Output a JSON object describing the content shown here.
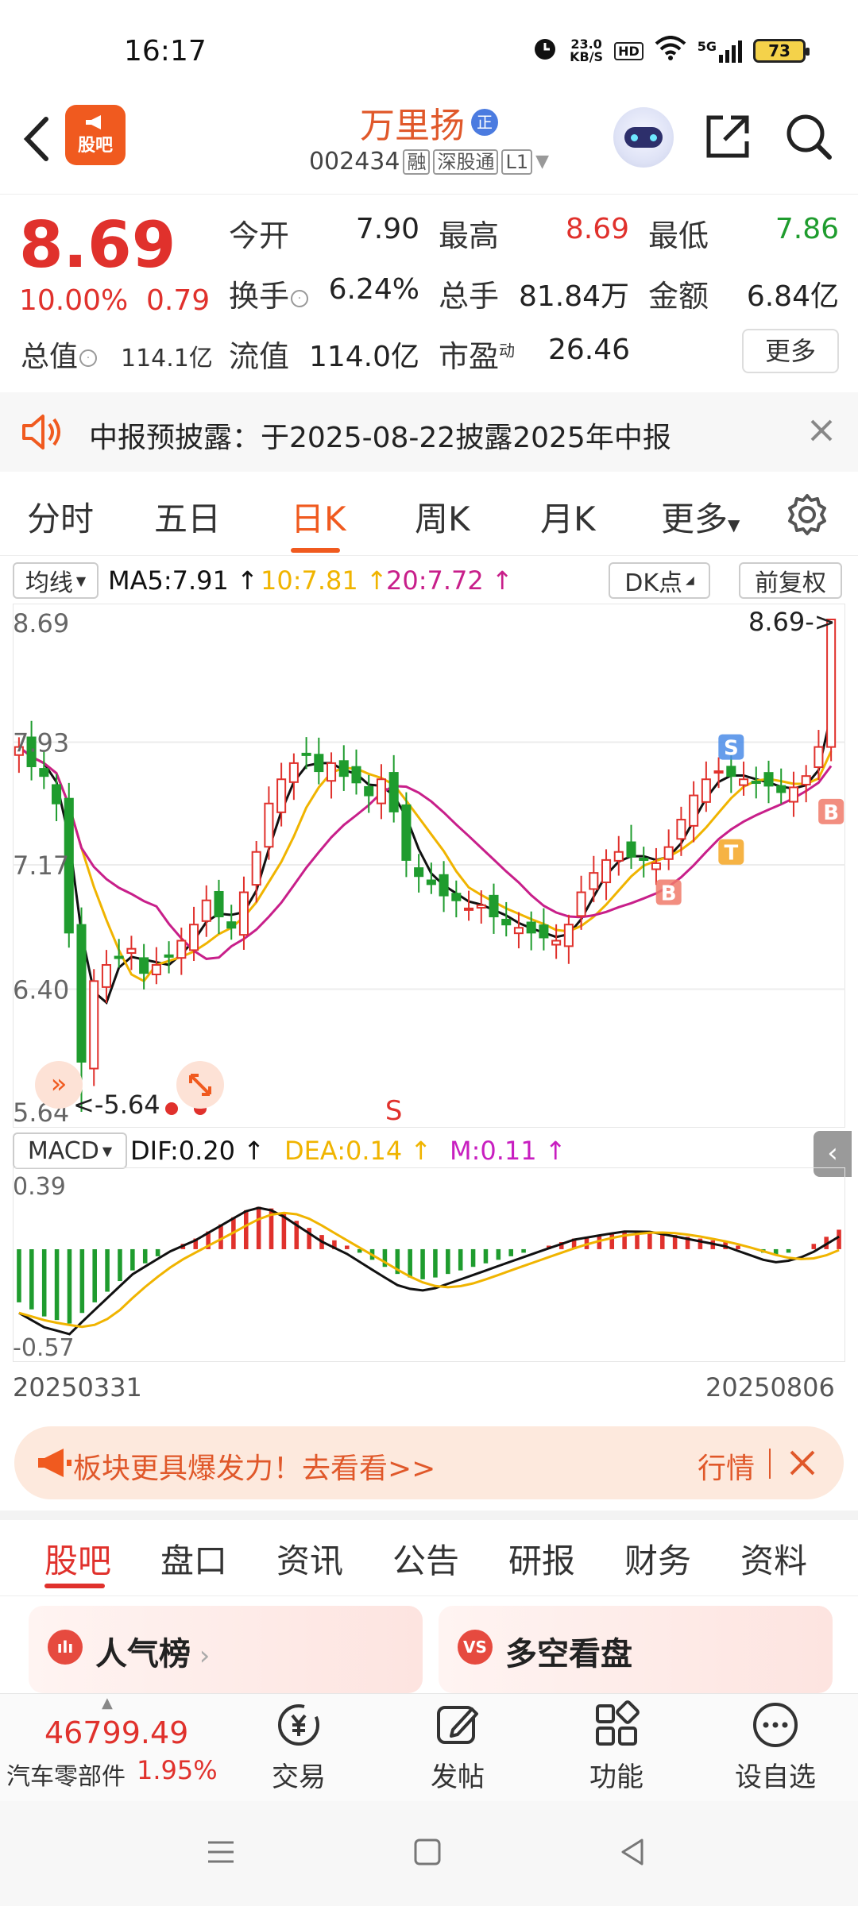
{
  "status_bar": {
    "time": "16:17",
    "net_speed_value": "23.0",
    "net_speed_unit": "KB/S",
    "hd": "HD",
    "network": "5G",
    "battery": "73"
  },
  "header": {
    "back_glyph": "‹",
    "logo_text": "股吧",
    "stock_name": "万里扬",
    "name_badge": "正",
    "stock_code": "002434",
    "tag_margin": "融",
    "tag_connect": "深股通",
    "tag_level": "L1"
  },
  "quote": {
    "price": "8.69",
    "change_pct": "10.00%",
    "change_amt": "0.79",
    "total_mv_label": "总值",
    "total_mv_value": "114.1亿",
    "open_label": "今开",
    "open_value": "7.90",
    "high_label": "最高",
    "high_value": "8.69",
    "low_label": "最低",
    "low_value": "7.86",
    "turnover_label": "换手",
    "turnover_value": "6.24%",
    "volume_label": "总手",
    "volume_value": "81.84万",
    "amount_label": "金额",
    "amount_value": "6.84亿",
    "float_mv_label": "流值",
    "float_mv_value": "114.0亿",
    "pe_label": "市盈",
    "pe_sup": "动",
    "pe_value": "26.46",
    "more_label": "更多"
  },
  "announcement": {
    "text": "中报预披露：于2025-08-22披露2025年中报"
  },
  "period_tabs": {
    "items": [
      "分时",
      "五日",
      "日K",
      "周K",
      "月K",
      "更多"
    ],
    "active": "日K"
  },
  "ma_legend": {
    "selector": "均线",
    "ma5": "MA5:7.91",
    "ma10": "10:7.81",
    "ma20": "20:7.72",
    "dk_label": "DK点",
    "adjust_label": "前复权"
  },
  "macd_legend": {
    "selector": "MACD",
    "dif": "DIF:0.20",
    "dea": "DEA:0.14",
    "m": "M:0.11"
  },
  "colors": {
    "up": "#e0312c",
    "down": "#1f9c2e",
    "ma5": "#111111",
    "ma10": "#f0b400",
    "ma20": "#c81f8a",
    "accent": "#f05a1f"
  },
  "chart_data": [
    {
      "type": "candlestick",
      "y_ticks": [
        "8.69",
        "7.93",
        "7.17",
        "6.40",
        "5.64"
      ],
      "ylim": [
        5.64,
        8.69
      ],
      "x_start_label": "20250331",
      "x_end_label": "20250806",
      "last_price_label": "8.69->",
      "low_label": "<-5.64",
      "markers": [
        "S",
        "B",
        "T",
        "B",
        "S"
      ],
      "closes": [
        7.9,
        7.78,
        7.72,
        7.55,
        6.75,
        5.95,
        6.45,
        6.55,
        6.6,
        6.65,
        6.5,
        6.55,
        6.6,
        6.7,
        6.8,
        6.95,
        6.85,
        6.78,
        7.0,
        7.25,
        7.55,
        7.7,
        7.8,
        7.85,
        7.75,
        7.8,
        7.72,
        7.68,
        7.6,
        7.7,
        7.5,
        7.2,
        7.1,
        7.05,
        6.98,
        6.95,
        6.9,
        6.92,
        6.85,
        6.8,
        6.78,
        6.75,
        6.72,
        6.7,
        6.8,
        7.0,
        7.12,
        7.2,
        7.25,
        7.22,
        7.2,
        7.18,
        7.28,
        7.45,
        7.6,
        7.7,
        7.75,
        7.72,
        7.7,
        7.68,
        7.66,
        7.62,
        7.65,
        7.72,
        7.9,
        8.69
      ]
    },
    {
      "type": "bar",
      "name": "MACD",
      "y_ticks": [
        "0.39",
        "-0.57"
      ],
      "ylim": [
        -0.57,
        0.39
      ],
      "values": [
        -0.3,
        -0.34,
        -0.38,
        -0.4,
        -0.42,
        -0.36,
        -0.3,
        -0.24,
        -0.18,
        -0.12,
        -0.08,
        -0.04,
        0.0,
        0.03,
        0.06,
        0.1,
        0.14,
        0.18,
        0.22,
        0.24,
        0.23,
        0.2,
        0.16,
        0.12,
        0.08,
        0.05,
        0.02,
        -0.02,
        -0.06,
        -0.1,
        -0.14,
        -0.16,
        -0.17,
        -0.16,
        -0.14,
        -0.12,
        -0.1,
        -0.08,
        -0.06,
        -0.04,
        -0.02,
        0.0,
        0.02,
        0.04,
        0.06,
        0.07,
        0.08,
        0.09,
        0.1,
        0.1,
        0.1,
        0.09,
        0.08,
        0.07,
        0.06,
        0.05,
        0.04,
        0.02,
        0.0,
        -0.02,
        -0.03,
        -0.02,
        0.0,
        0.03,
        0.07,
        0.11
      ]
    }
  ],
  "promo": {
    "text": "板块更具爆发力！去看看>>",
    "link": "行情"
  },
  "section_tabs": {
    "items": [
      "股吧",
      "盘口",
      "资讯",
      "公告",
      "研报",
      "财务",
      "资料"
    ],
    "active": "股吧"
  },
  "cards": {
    "popularity": "人气榜",
    "popularity_icon": "ılı",
    "bull_bear": "多空看盘",
    "bull_bear_icon": "VS"
  },
  "bottom_bar": {
    "index_value": "46799.49",
    "index_name": "汽车零部件",
    "index_change": "1.95%",
    "nav_items": [
      "交易",
      "发帖",
      "功能",
      "设自选"
    ]
  }
}
